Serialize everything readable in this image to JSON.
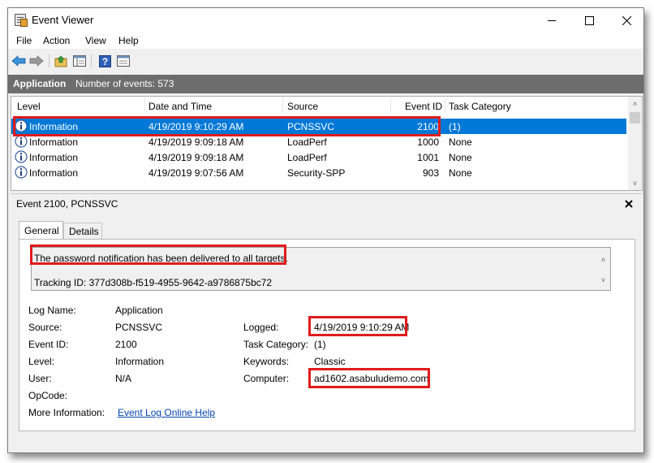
{
  "window": {
    "title": "Event Viewer"
  },
  "menu": [
    "File",
    "Action",
    "View",
    "Help"
  ],
  "toolbar": {
    "buttons": [
      "back-arrow-icon",
      "forward-arrow-icon",
      "folder-up-icon",
      "show-hide-tree-icon",
      "help-icon",
      "properties-icon"
    ]
  },
  "log_header": {
    "name": "Application",
    "count_text": "Number of events: 573"
  },
  "table": {
    "columns": [
      "Level",
      "Date and Time",
      "Source",
      "Event ID",
      "Task Category"
    ],
    "rows": [
      {
        "level": "Information",
        "date": "4/19/2019 9:10:29 AM",
        "source": "PCNSSVC",
        "event_id": "2100",
        "category": "(1)",
        "selected": true
      },
      {
        "level": "Information",
        "date": "4/19/2019 9:09:18 AM",
        "source": "LoadPerf",
        "event_id": "1000",
        "category": "None",
        "selected": false
      },
      {
        "level": "Information",
        "date": "4/19/2019 9:09:18 AM",
        "source": "LoadPerf",
        "event_id": "1001",
        "category": "None",
        "selected": false
      },
      {
        "level": "Information",
        "date": "4/19/2019 9:07:56 AM",
        "source": "Security-SPP",
        "event_id": "903",
        "category": "None",
        "selected": false
      }
    ]
  },
  "detail": {
    "title": "Event 2100, PCNSSVC",
    "tabs": [
      "General",
      "Details"
    ],
    "message": "The password notification has been delivered to all targets.",
    "tracking": "Tracking ID: 377d308b-f519-4955-9642-a9786875bc72",
    "fields": {
      "log_name_label": "Log Name:",
      "log_name": "Application",
      "source_label": "Source:",
      "source": "PCNSSVC",
      "event_id_label": "Event ID:",
      "event_id": "2100",
      "level_label": "Level:",
      "level": "Information",
      "user_label": "User:",
      "user": "N/A",
      "opcode_label": "OpCode:",
      "more_info_label": "More Information:",
      "more_info_link": "Event Log Online Help",
      "logged_label": "Logged:",
      "logged": "4/19/2019 9:10:29 AM",
      "task_category_label": "Task Category:",
      "task_category": "(1)",
      "keywords_label": "Keywords:",
      "keywords": "Classic",
      "computer_label": "Computer:",
      "computer": "ad1602.asabuludemo.com"
    }
  },
  "colors": {
    "selection": "#0078d7",
    "highlight_box": "#e01b1b",
    "header_bar": "#6d6d6d"
  }
}
